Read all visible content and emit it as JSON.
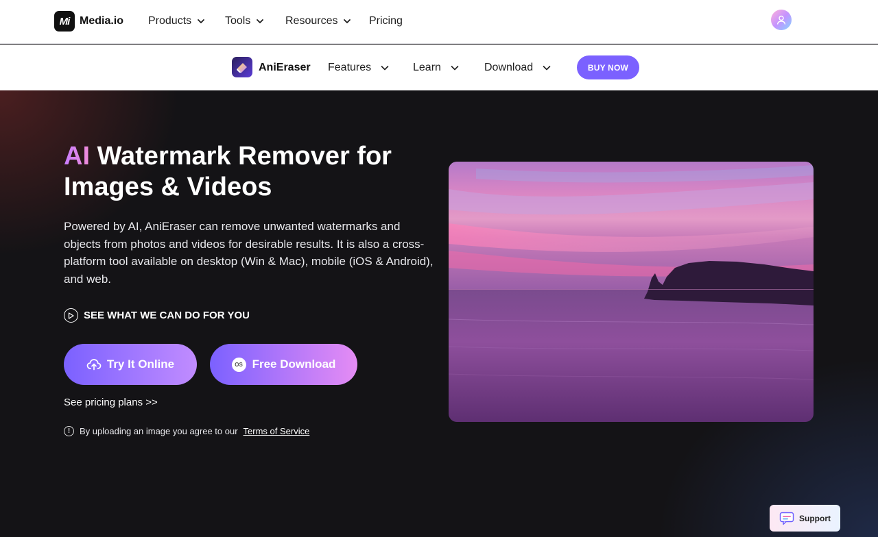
{
  "topnav": {
    "brand": "Media.io",
    "brand_logo_text": "Mi",
    "items": [
      {
        "label": "Products",
        "has_dropdown": true
      },
      {
        "label": "Tools",
        "has_dropdown": true
      },
      {
        "label": "Resources",
        "has_dropdown": true
      },
      {
        "label": "Pricing",
        "has_dropdown": false
      }
    ],
    "avatar_icon": "user-icon"
  },
  "subnav": {
    "product_name": "AniEraser",
    "product_icon": "eraser-icon",
    "items": [
      {
        "label": "Features"
      },
      {
        "label": "Learn"
      },
      {
        "label": "Download"
      }
    ],
    "buy_label": "BUY NOW"
  },
  "hero": {
    "headline_accent": "AI",
    "headline_rest": "Watermark Remover for Images & Videos",
    "description": "Powered by AI, AniEraser can remove unwanted watermarks and objects from photos and videos for desirable results. It is also a cross-platform tool available on desktop (Win & Mac), mobile (iOS & Android), and web.",
    "see_what_label": "SEE WHAT WE CAN DO FOR YOU",
    "try_online_label": "Try It Online",
    "free_download_label": "Free Download",
    "os_badge_text": "OS",
    "pricing_link": "See pricing plans >>",
    "terms_prefix": "By uploading an image you agree to our",
    "terms_link": "Terms of Service"
  },
  "support": {
    "label": "Support"
  },
  "colors": {
    "accent": "#7b61ff",
    "hero_bg": "#141316",
    "accent_pink": "#f08bd8"
  }
}
